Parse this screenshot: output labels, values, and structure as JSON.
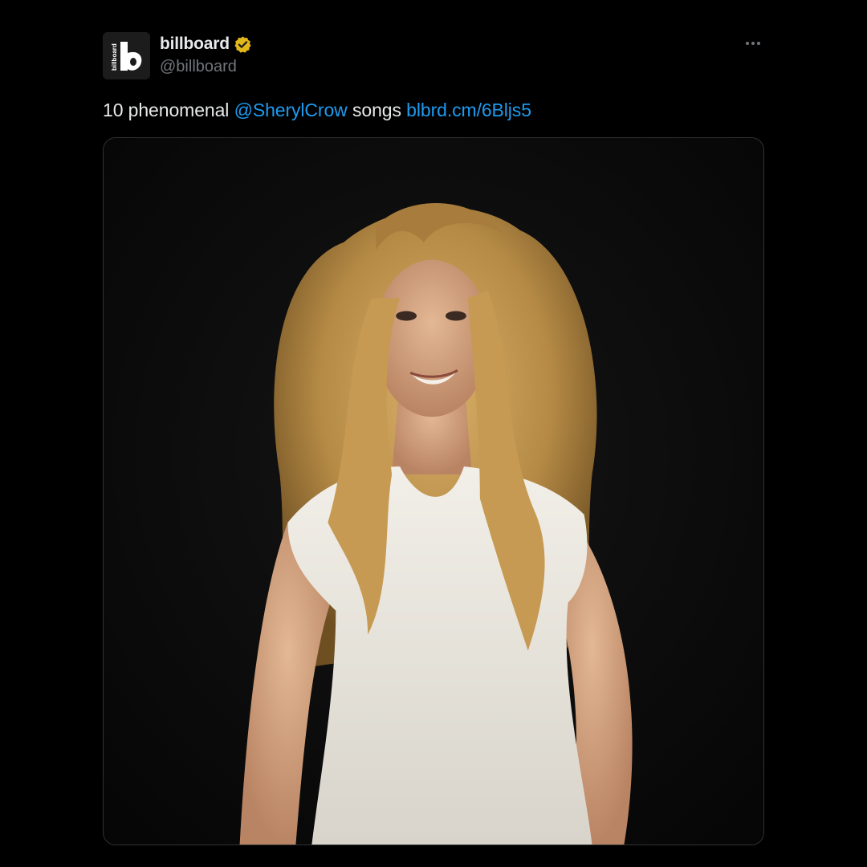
{
  "author": {
    "display_name": "billboard",
    "handle": "@billboard",
    "avatar_icon": "billboard-logo-icon",
    "avatar_logo_text": "billboard",
    "verified_icon": "verified-gold-badge-icon",
    "verified_color": "#e2b719"
  },
  "more_icon": "more-horizontal-icon",
  "tweet": {
    "text_prefix": "10 phenomenal ",
    "mention": "@SherylCrow",
    "text_middle": " songs ",
    "link": "blbrd.cm/6Bljs5"
  },
  "media": {
    "type": "photo"
  },
  "colors": {
    "background": "#000000",
    "text": "#e7e9ea",
    "secondary_text": "#71767b",
    "link": "#1d9bf0",
    "border": "#2f3336"
  }
}
